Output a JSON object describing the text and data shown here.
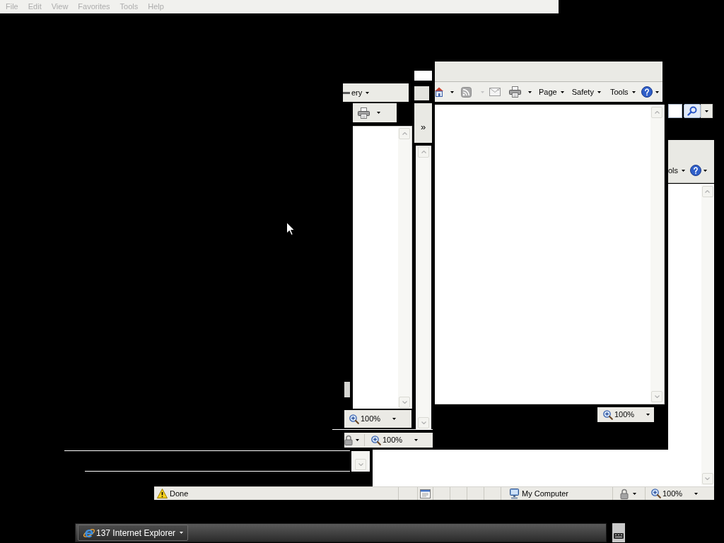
{
  "menu_bar": {
    "items": [
      {
        "label": "File",
        "disabled": true
      },
      {
        "label": "Edit",
        "disabled": true
      },
      {
        "label": "View",
        "disabled": true
      },
      {
        "label": "Favorites",
        "disabled": true
      },
      {
        "label": "Tools",
        "disabled": true
      },
      {
        "label": "Help",
        "disabled": true
      }
    ]
  },
  "back_window": {
    "toolbar_menu": "ery",
    "zoom": "100%"
  },
  "middle_window": {
    "chevron": "»",
    "zoom": "100%"
  },
  "front_window": {
    "toolbar_menus": [
      "Page",
      "Safety",
      "Tools"
    ],
    "zoom": "100%"
  },
  "right_window": {
    "toolbar_menu": "ols",
    "status_bar": {
      "status": "Done",
      "zone": "My Computer",
      "zoom": "100%"
    }
  },
  "taskbar": {
    "group_button": "137 Internet Explorer"
  }
}
